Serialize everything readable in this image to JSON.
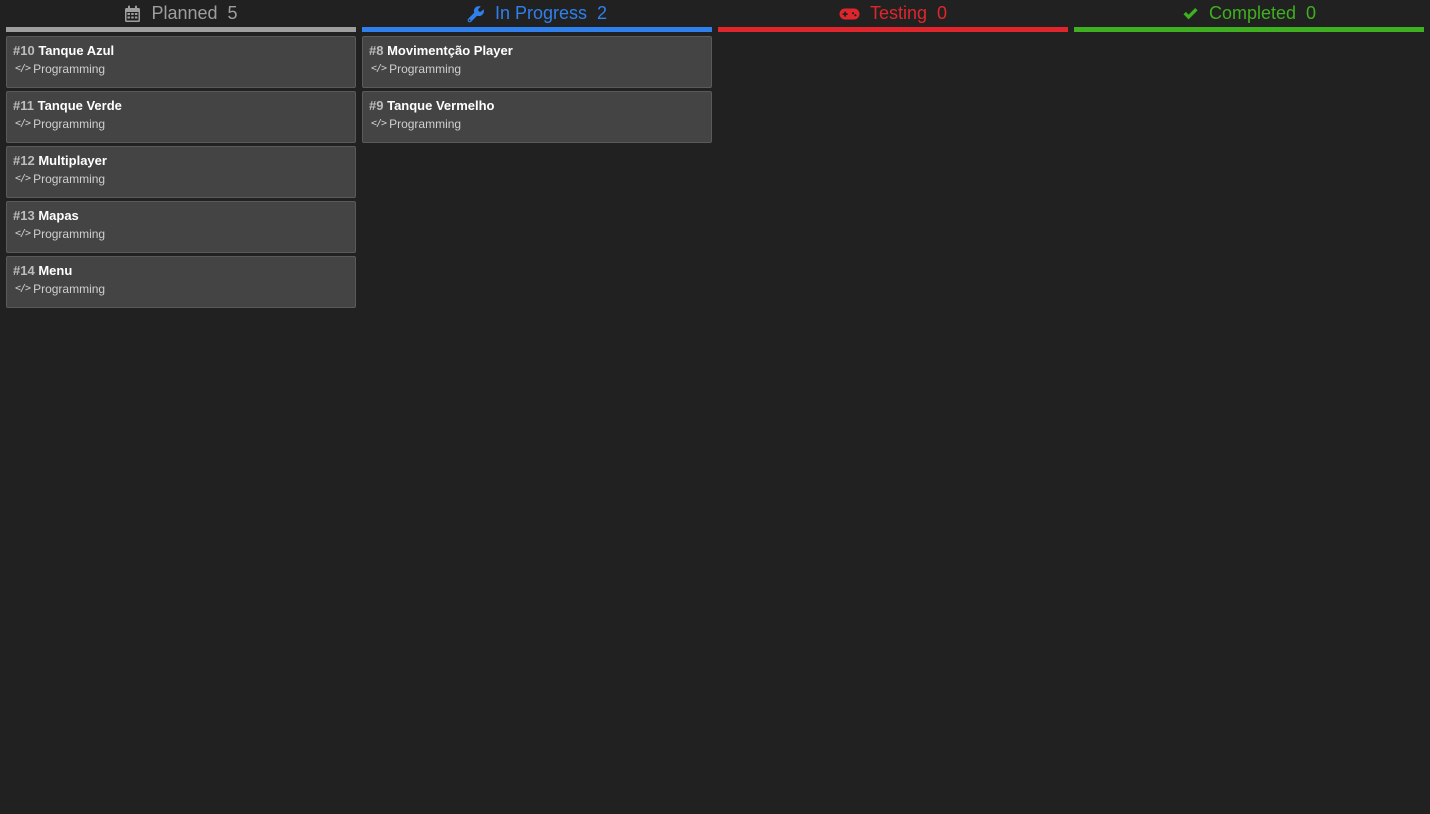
{
  "columns": [
    {
      "title": "Planned",
      "count": "5",
      "icon": "calendar-icon",
      "color": "#9e9e9e",
      "bar_color": "#9e9e9e",
      "cards": [
        {
          "number": "#10",
          "title": "Tanque Azul",
          "tag": "Programming",
          "tag_icon": "code-icon"
        },
        {
          "number": "#11",
          "title": "Tanque Verde",
          "tag": "Programming",
          "tag_icon": "code-icon"
        },
        {
          "number": "#12",
          "title": "Multiplayer",
          "tag": "Programming",
          "tag_icon": "code-icon"
        },
        {
          "number": "#13",
          "title": "Mapas",
          "tag": "Programming",
          "tag_icon": "code-icon"
        },
        {
          "number": "#14",
          "title": "Menu",
          "tag": "Programming",
          "tag_icon": "code-icon"
        }
      ]
    },
    {
      "title": "In Progress",
      "count": "2",
      "icon": "wrench-icon",
      "color": "#2f80ed",
      "bar_color": "#2f80ed",
      "cards": [
        {
          "number": "#8",
          "title": "Movimentção Player",
          "tag": "Programming",
          "tag_icon": "code-icon"
        },
        {
          "number": "#9",
          "title": "Tanque Vermelho",
          "tag": "Programming",
          "tag_icon": "code-icon"
        }
      ]
    },
    {
      "title": "Testing",
      "count": "0",
      "icon": "gamepad-icon",
      "color": "#e0262c",
      "bar_color": "#e0262c",
      "cards": []
    },
    {
      "title": "Completed",
      "count": "0",
      "icon": "check-icon",
      "color": "#3fb01f",
      "bar_color": "#3fb01f",
      "cards": []
    }
  ]
}
